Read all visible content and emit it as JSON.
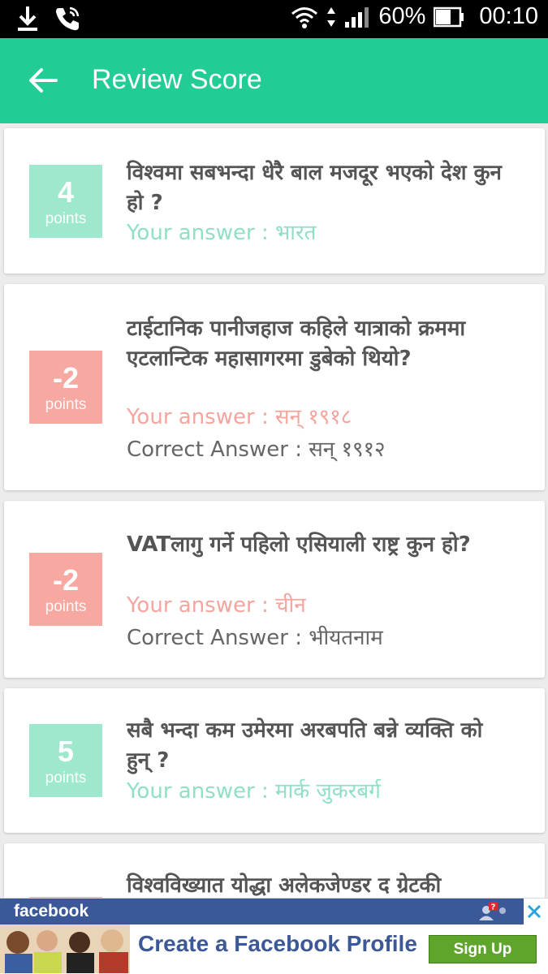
{
  "status_bar": {
    "battery_percent": "60%",
    "time": "00:10",
    "icons": [
      "download-icon",
      "phone-call-icon",
      "wifi-icon",
      "data-arrows-icon",
      "signal-icon",
      "battery-icon"
    ]
  },
  "app_bar": {
    "title": "Review Score",
    "back_icon": "arrow-left-icon",
    "color": "#22cc96"
  },
  "colors": {
    "positive": "#9ee8cd",
    "negative": "#f7a8a1"
  },
  "cards": [
    {
      "score": "4",
      "unit": "points",
      "question": "विश्वमा सबभन्दा धेरै बाल मजदूर भएको देश कुन हो ?",
      "your_answer": "Your answer : भारत"
    },
    {
      "score": "-2",
      "unit": "points",
      "question": "टाईटानिक पानीजहाज कहिले यात्राको क्रममा एटलान्टिक महासागरमा डुबेको थियो?",
      "your_answer": "Your answer : सन् १९१८",
      "correct_answer": "Correct Answer : सन् १९१२"
    },
    {
      "score": "-2",
      "unit": "points",
      "question": "VATलागु गर्ने पहिलो एसियाली राष्ट्र कुन हो?",
      "your_answer": "Your answer : चीन",
      "correct_answer": "Correct Answer : भीयतनाम"
    },
    {
      "score": "5",
      "unit": "points",
      "question": "सबै भन्दा कम उमेरमा अरबपति बन्ने व्यक्ति को हुन् ?",
      "your_answer": "Your answer : मार्क जुकरबर्ग"
    },
    {
      "question": "विश्वविख्यात योद्धा अलेकजेण्डर द ग्रेटकी"
    }
  ],
  "ad": {
    "brand": "facebook",
    "headline": "Create a Facebook Profile",
    "button": "Sign Up",
    "notification_count": "?",
    "close_icon": "close-icon"
  }
}
